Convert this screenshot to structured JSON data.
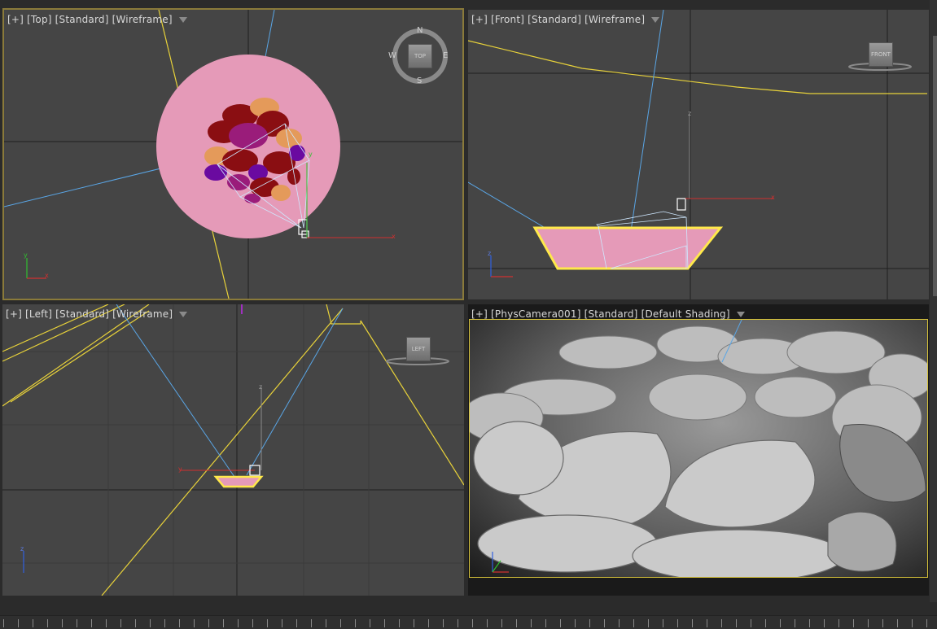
{
  "viewports": {
    "top": {
      "labels": [
        "[+]",
        "[Top]",
        "[Standard]",
        "[Wireframe]"
      ]
    },
    "front": {
      "labels": [
        "[+]",
        "[Front]",
        "[Standard]",
        "[Wireframe]"
      ]
    },
    "left": {
      "labels": [
        "[+]",
        "[Left]",
        "[Standard]",
        "[Wireframe]"
      ]
    },
    "camera": {
      "labels": [
        "[+]",
        "[PhysCamera001]",
        "[Standard]",
        "[Default Shading]"
      ]
    }
  },
  "viewcube": {
    "top_face": "TOP",
    "front_face": "FRONT",
    "left_face": "LEFT",
    "compass": {
      "n": "N",
      "s": "S",
      "e": "E",
      "w": "W"
    }
  },
  "axes": {
    "x": "x",
    "y": "y",
    "z": "z"
  },
  "colors": {
    "background": "#454545",
    "grid": "#3a3a3a",
    "selection_yellow": "#e8d23a",
    "camera_blue": "#5aa6e6",
    "plate_pink": "#e59ab8",
    "axis_red": "#d03030",
    "axis_green": "#30c030",
    "axis_blue": "#3060e0"
  }
}
